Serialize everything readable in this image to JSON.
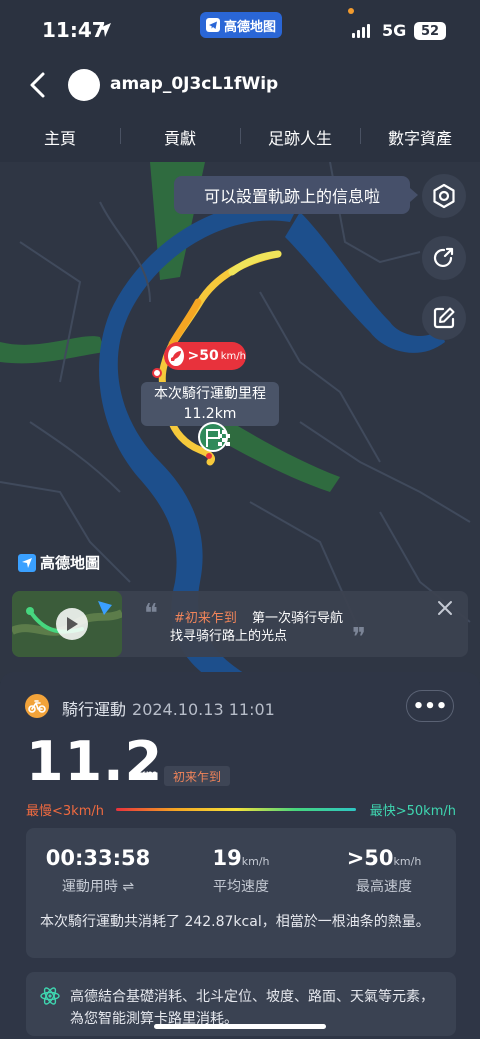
{
  "status": {
    "time": "11:47",
    "app_pill": "高德地图",
    "network": "5G",
    "battery": "52"
  },
  "header": {
    "username": "amap_0J3cL1fWip"
  },
  "tabs": [
    {
      "label": "主頁"
    },
    {
      "label": "貢獻"
    },
    {
      "label": "足跡人生"
    },
    {
      "label": "數字資產"
    }
  ],
  "map": {
    "tooltip": "可以設置軌跡上的信息啦",
    "speed_badge": {
      "value": ">50",
      "unit": "km/h"
    },
    "distance_label": {
      "title": "本次騎行運動里程",
      "value": "11.2km"
    },
    "brand": "高德地圖",
    "icons": [
      "settings-icon",
      "share-icon",
      "edit-icon"
    ],
    "promo": {
      "tag": "#初来乍到",
      "line1": "第一次骑行导航",
      "line2": "找寻骑行路上的光点"
    },
    "colors": {
      "water": "#1d4f8c",
      "green": "#2f6b3f",
      "route_start": "#e8323c",
      "route_end": "#f6e23b"
    }
  },
  "activity": {
    "type": "騎行運動",
    "datetime": "2024.10.13 11:01",
    "distance": "11.2",
    "distance_unit": "km",
    "badge": "初来乍到",
    "legend": {
      "slow": "最慢<3km/h",
      "fast": "最快>50km/h"
    },
    "stats": [
      {
        "value": "00:33:58",
        "unit": "",
        "label": "運動用時 ⇌"
      },
      {
        "value": "19",
        "unit": "km/h",
        "label": "平均速度"
      },
      {
        "value": ">50",
        "unit": "km/h",
        "label": "最高速度"
      }
    ],
    "calorie_text": "本次騎行運動共消耗了 242.87kcal，相當於一根油条的熱量。",
    "info_text": "高德結合基礎消耗、北斗定位、坡度、路面、天氣等元素，為您智能測算卡路里消耗。"
  }
}
